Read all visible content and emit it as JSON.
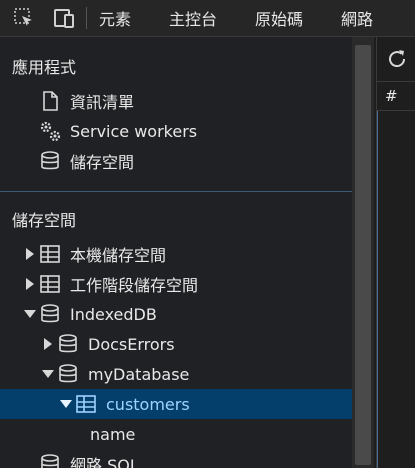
{
  "toolbar": {
    "tabs": [
      "元素",
      "主控台",
      "原始碼",
      "網路"
    ]
  },
  "sidebar": {
    "application": {
      "title": "應用程式",
      "items": [
        {
          "label": "資訊清單",
          "icon": "document-icon"
        },
        {
          "label": "Service workers",
          "icon": "gears-icon"
        },
        {
          "label": "儲存空間",
          "icon": "database-icon"
        }
      ]
    },
    "storage": {
      "title": "儲存空間",
      "items": [
        {
          "label": "本機儲存空間",
          "icon": "table-icon",
          "expanded": false
        },
        {
          "label": "工作階段儲存空間",
          "icon": "table-icon",
          "expanded": false
        },
        {
          "label": "IndexedDB",
          "icon": "database-icon",
          "expanded": true
        },
        {
          "label": "DocsErrors",
          "icon": "database-icon",
          "expanded": false
        },
        {
          "label": "myDatabase",
          "icon": "database-icon",
          "expanded": true
        },
        {
          "label": "customers",
          "icon": "table-icon",
          "expanded": true,
          "selected": true
        },
        {
          "label": "name"
        },
        {
          "label": "網路 SQL",
          "icon": "database-icon"
        }
      ]
    }
  },
  "right_panel": {
    "header": "#"
  },
  "colors": {
    "selected_bg": "#043f6b",
    "selected_text": "#9fd3ff"
  }
}
